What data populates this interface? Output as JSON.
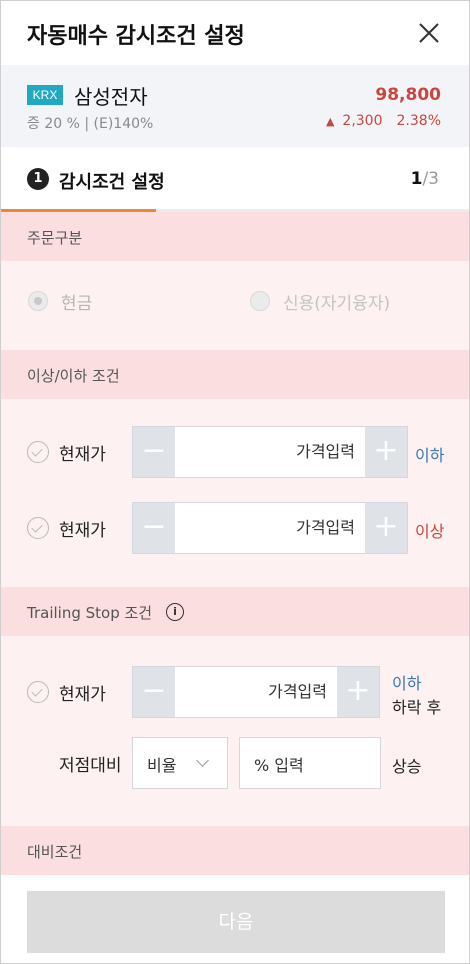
{
  "header": {
    "title": "자동매수 감시조건 설정",
    "close_icon": "close-icon"
  },
  "stock": {
    "market": "KRX",
    "name": "삼성전자",
    "price": "98,800",
    "meta": "증 20 % | (E)140%",
    "change_icon": "triangle-up-icon",
    "change": "2,300",
    "change_pct": "2.38%",
    "up_color": "#c8473f"
  },
  "step": {
    "number": "1",
    "label": "감시조건 설정",
    "current": "1",
    "total": "/3",
    "progress_fraction": 0.33,
    "progress_color": "#e8893a"
  },
  "order_type": {
    "title": "주문구분",
    "options": [
      {
        "label": "현금",
        "selected": true
      },
      {
        "label": "신용(자기융자)",
        "selected": false
      }
    ]
  },
  "threshold": {
    "title": "이상/이하 조건",
    "rows": [
      {
        "label": "현재가",
        "minus": "−",
        "placeholder": "가격입력",
        "plus": "+",
        "direction": "이하"
      },
      {
        "label": "현재가",
        "minus": "−",
        "placeholder": "가격입력",
        "plus": "+",
        "direction": "이상"
      }
    ]
  },
  "trailing": {
    "title": "Trailing Stop 조건",
    "info_icon": "info-icon",
    "row": {
      "label": "현재가",
      "minus": "−",
      "placeholder": "가격입력",
      "plus": "+",
      "direction": "이하",
      "suffix": "하락 후"
    },
    "low_compare": {
      "label": "저점대비",
      "select_value": "비율",
      "input_placeholder": "% 입력",
      "suffix": "상승"
    }
  },
  "comparison": {
    "title": "대비조건"
  },
  "footer": {
    "next_label": "다음"
  },
  "colors": {
    "section_header": "#fbdfe0",
    "section_body": "#fdf1f1",
    "below": "#3a77b3",
    "above": "#c8473f"
  }
}
